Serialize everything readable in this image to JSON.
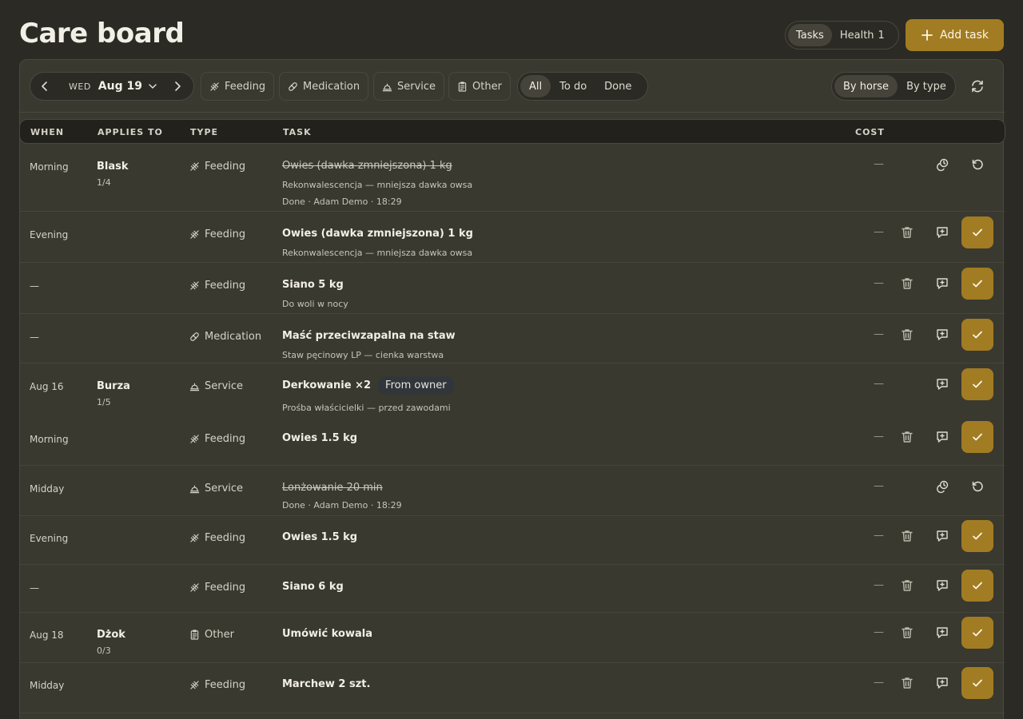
{
  "header": {
    "title": "Care board",
    "view_tabs": [
      {
        "label": "Tasks",
        "active": true
      },
      {
        "label": "Health",
        "count": "1",
        "active": false
      }
    ],
    "add_task_label": "Add task"
  },
  "toolbar": {
    "date_nav": {
      "weekday": "WED",
      "date": "Aug 19"
    },
    "type_filters": [
      {
        "label": "Feeding",
        "icon": "feeding-icon"
      },
      {
        "label": "Medication",
        "icon": "pill-icon"
      },
      {
        "label": "Service",
        "icon": "service-bell-icon"
      },
      {
        "label": "Other",
        "icon": "clipboard-icon"
      }
    ],
    "status_filters": [
      {
        "label": "All",
        "active": true
      },
      {
        "label": "To do",
        "active": false
      },
      {
        "label": "Done",
        "active": false
      }
    ],
    "group_by": [
      {
        "label": "By horse",
        "active": true
      },
      {
        "label": "By type",
        "active": false
      }
    ]
  },
  "table": {
    "columns": [
      "WHEN",
      "APPLIES TO",
      "TYPE",
      "TASK",
      "COST"
    ],
    "rows": [
      {
        "when": "Morning",
        "horse": "Blask",
        "progress": "1/4",
        "type": "Feeding",
        "task": "Owies (dawka zmniejszona) 1 kg",
        "note": "Rekonwalescencja — mniejsza dawka owsa",
        "done_note": "Done · Adam Demo · 18:29",
        "cost": "—",
        "done": true
      },
      {
        "when": "Evening",
        "horse": "",
        "progress": "",
        "type": "Feeding",
        "task": "Owies (dawka zmniejszona) 1 kg",
        "note": "Rekonwalescencja — mniejsza dawka owsa",
        "cost": "—",
        "done": false
      },
      {
        "when": "—",
        "horse": "",
        "progress": "",
        "type": "Feeding",
        "task": "Siano 5 kg",
        "note": "Do woli w nocy",
        "cost": "—",
        "done": false
      },
      {
        "when": "—",
        "horse": "",
        "progress": "",
        "type": "Medication",
        "task": "Maść przeciwzapalna na staw",
        "note": "Staw pęcinowy LP — cienka warstwa",
        "cost": "—",
        "done": false
      },
      {
        "when": "Aug 16",
        "horse": "Burza",
        "progress": "1/5",
        "type": "Service",
        "task": "Derkowanie ×2",
        "badge": "From owner",
        "note": "Prośba właścicielki — przed zawodami",
        "cost": "—",
        "done": false
      },
      {
        "when": "Morning",
        "horse": "",
        "progress": "",
        "type": "Feeding",
        "task": "Owies 1.5 kg",
        "cost": "—",
        "done": false
      },
      {
        "when": "Midday",
        "horse": "",
        "progress": "",
        "type": "Service",
        "task": "Lonżowanie 20 min",
        "done_note": "Done · Adam Demo · 18:29",
        "cost": "—",
        "done": true
      },
      {
        "when": "Evening",
        "horse": "",
        "progress": "",
        "type": "Feeding",
        "task": "Owies 1.5 kg",
        "cost": "—",
        "done": false
      },
      {
        "when": "—",
        "horse": "",
        "progress": "",
        "type": "Feeding",
        "task": "Siano 6 kg",
        "cost": "—",
        "done": false
      },
      {
        "when": "Aug 18",
        "horse": "Dżok",
        "progress": "0/3",
        "type": "Other",
        "task": "Umówić kowala",
        "cost": "—",
        "done": false
      },
      {
        "when": "Midday",
        "horse": "",
        "progress": "",
        "type": "Feeding",
        "task": "Marchew 2 szt.",
        "cost": "—",
        "done": false
      }
    ]
  },
  "colors": {
    "background": "#2b2a24",
    "panel": "#3a3930",
    "accent": "#a27c22",
    "badge": "#31363b"
  }
}
